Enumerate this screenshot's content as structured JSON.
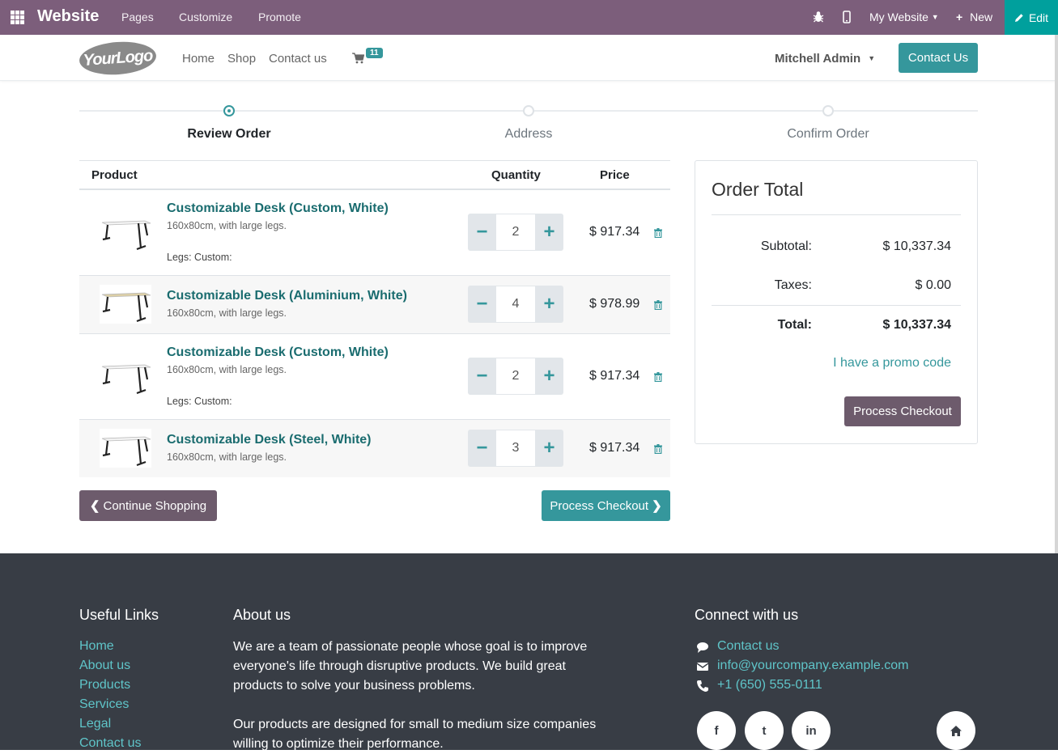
{
  "admin_bar": {
    "brand": "Website",
    "menu": [
      "Pages",
      "Customize",
      "Promote"
    ],
    "my_website": "My Website",
    "new_label": "New",
    "edit_label": "Edit"
  },
  "header": {
    "logo_text": "YourLogo",
    "nav": [
      "Home",
      "Shop",
      "Contact us"
    ],
    "cart_count": "11",
    "user": "Mitchell Admin",
    "contact_button": "Contact Us"
  },
  "steps": [
    {
      "label": "Review Order",
      "active": true
    },
    {
      "label": "Address",
      "active": false
    },
    {
      "label": "Confirm Order",
      "active": false
    }
  ],
  "table": {
    "headers": {
      "product": "Product",
      "quantity": "Quantity",
      "price": "Price"
    },
    "rows": [
      {
        "name": "Customizable Desk (Custom, White)",
        "desc": "160x80cm, with large legs.",
        "legs": "Legs: Custom:",
        "qty": "2",
        "price": "$ 917.34",
        "top_color": "#f2f2f2"
      },
      {
        "name": "Customizable Desk (Aluminium, White)",
        "desc": "160x80cm, with large legs.",
        "legs": "",
        "qty": "4",
        "price": "$ 978.99",
        "top_color": "#dccfa6"
      },
      {
        "name": "Customizable Desk (Custom, White)",
        "desc": "160x80cm, with large legs.",
        "legs": "Legs: Custom:",
        "qty": "2",
        "price": "$ 917.34",
        "top_color": "#f2f2f2"
      },
      {
        "name": "Customizable Desk (Steel, White)",
        "desc": "160x80cm, with large legs.",
        "legs": "",
        "qty": "3",
        "price": "$ 917.34",
        "top_color": "#f2f2f2"
      }
    ]
  },
  "actions": {
    "continue": "Continue Shopping",
    "checkout": "Process Checkout"
  },
  "order_total": {
    "title": "Order Total",
    "subtotal_label": "Subtotal:",
    "subtotal": "$ 10,337.34",
    "taxes_label": "Taxes:",
    "taxes": "$ 0.00",
    "total_label": "Total:",
    "total": "$ 10,337.34",
    "promo": "I have a promo code",
    "checkout": "Process Checkout"
  },
  "footer": {
    "useful_links_title": "Useful Links",
    "links": [
      "Home",
      "About us",
      "Products",
      "Services",
      "Legal",
      "Contact us"
    ],
    "about_title": "About us",
    "about_p1": "We are a team of passionate people whose goal is to improve everyone's life through disruptive products. We build great products to solve your business problems.",
    "about_p2": "Our products are designed for small to medium size companies willing to optimize their performance.",
    "connect_title": "Connect with us",
    "contact_label": "Contact us",
    "email": "info@yourcompany.example.com",
    "phone": "+1 (650) 555-0111",
    "social": [
      "f",
      "t",
      "in",
      "home"
    ]
  },
  "colors": {
    "admin": "#7c5e7b",
    "primary": "#35979c",
    "secondary": "#6d5b6c",
    "footer": "#383d45"
  }
}
